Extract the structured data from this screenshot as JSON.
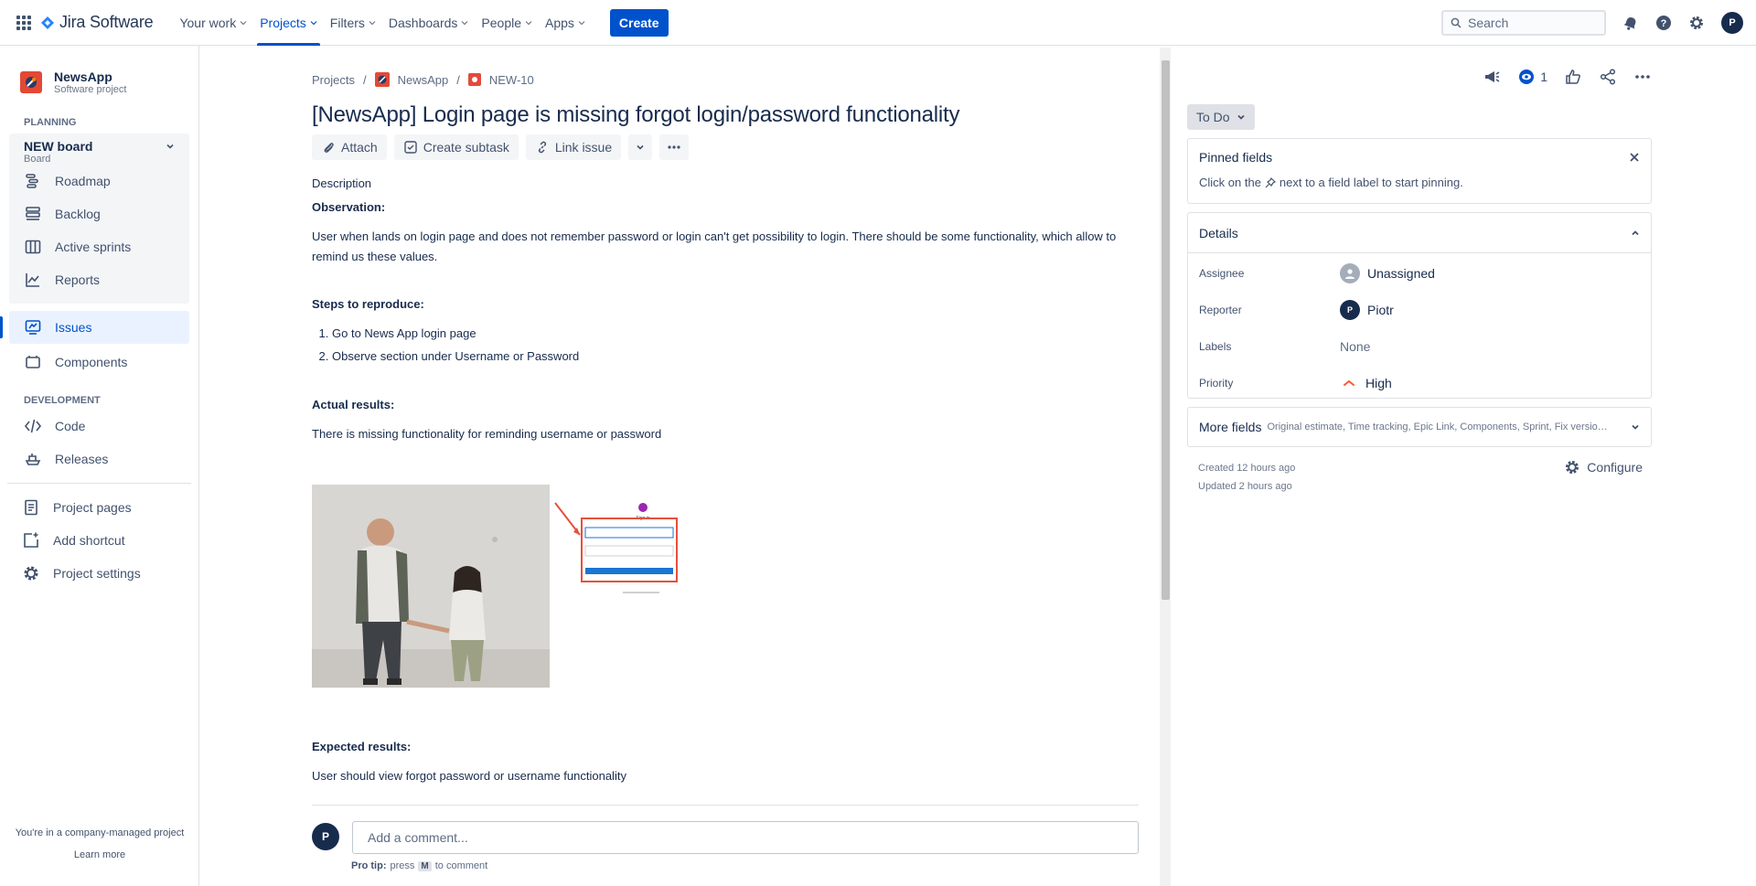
{
  "topnav": {
    "logo_text": "Jira Software",
    "items": [
      {
        "label": "Your work"
      },
      {
        "label": "Projects"
      },
      {
        "label": "Filters"
      },
      {
        "label": "Dashboards"
      },
      {
        "label": "People"
      },
      {
        "label": "Apps"
      }
    ],
    "create_label": "Create",
    "search_placeholder": "Search",
    "avatar_initial": "P"
  },
  "sidebar": {
    "project_name": "NewsApp",
    "project_type": "Software project",
    "planning_heading": "PLANNING",
    "board_title": "NEW board",
    "board_sub": "Board",
    "planning_items": [
      {
        "label": "Roadmap"
      },
      {
        "label": "Backlog"
      },
      {
        "label": "Active sprints"
      },
      {
        "label": "Reports"
      }
    ],
    "issues_label": "Issues",
    "components_label": "Components",
    "development_heading": "DEVELOPMENT",
    "dev_items": [
      {
        "label": "Code"
      },
      {
        "label": "Releases"
      }
    ],
    "bottom_items": [
      {
        "label": "Project pages"
      },
      {
        "label": "Add shortcut"
      },
      {
        "label": "Project settings"
      }
    ],
    "footer_text": "You're in a company-managed project",
    "footer_link": "Learn more"
  },
  "issue": {
    "breadcrumbs": [
      "Projects",
      "NewsApp",
      "NEW-10"
    ],
    "title": "[NewsApp] Login page is missing forgot login/password functionality",
    "actions": {
      "attach": "Attach",
      "subtask": "Create subtask",
      "link": "Link issue"
    },
    "description_label": "Description",
    "observation_heading": "Observation:",
    "observation_text": "User when lands on login page and does not remember password or login can't get possibility to login. There should be some functionality, which allow to remind us these values.",
    "steps_heading": "Steps to reproduce:",
    "steps": [
      "Go to News App login page",
      "Observe section under Username or Password"
    ],
    "actual_heading": "Actual results:",
    "actual_text": "There is missing functionality for reminding username or password",
    "expected_heading": "Expected results:",
    "expected_text": "User should view forgot password or username functionality",
    "screenshot_caption": "Sign in",
    "comment_placeholder": "Add a comment...",
    "comment_avatar": "P",
    "pro_tip_bold": "Pro tip:",
    "pro_tip_press": "press",
    "pro_tip_key": "M",
    "pro_tip_rest": "to comment"
  },
  "panel": {
    "watch_count": "1",
    "status": "To Do",
    "pinned_title": "Pinned fields",
    "pinned_text_pre": "Click on the",
    "pinned_text_post": "next to a field label to start pinning.",
    "details_title": "Details",
    "fields": {
      "assignee_label": "Assignee",
      "assignee_value": "Unassigned",
      "reporter_label": "Reporter",
      "reporter_value": "Piotr",
      "reporter_initial": "P",
      "labels_label": "Labels",
      "labels_value": "None",
      "priority_label": "Priority",
      "priority_value": "High"
    },
    "more_fields_title": "More fields",
    "more_fields_sub": "Original estimate, Time tracking, Epic Link, Components, Sprint, Fix versions, Aff...",
    "created": "Created 12 hours ago",
    "updated": "Updated 2 hours ago",
    "configure": "Configure"
  },
  "colors": {
    "brand_blue": "#0052CC",
    "text_dark": "#172B4D",
    "priority_high": "#FF5630",
    "project_icon": "#E34935"
  }
}
